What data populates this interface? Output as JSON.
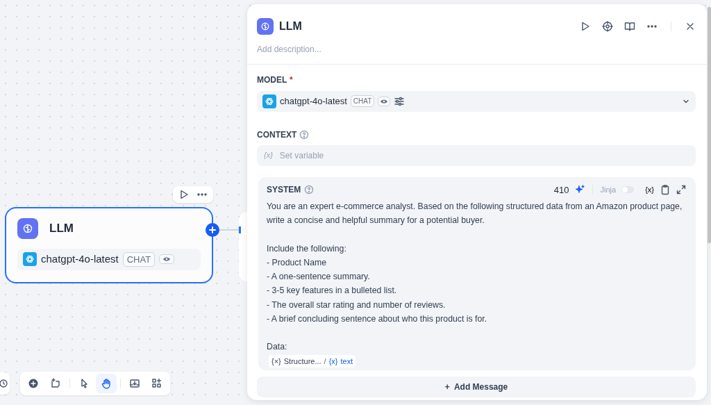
{
  "canvas": {
    "node": {
      "title": "LLM",
      "model": "chatgpt-4o-latest",
      "mode_tag": "CHAT",
      "selected": true
    },
    "toolbar": [
      {
        "kind": "add",
        "selected": false
      },
      {
        "kind": "note",
        "selected": false
      },
      {
        "kind": "pointer",
        "selected": false
      },
      {
        "kind": "hand",
        "selected": true
      },
      {
        "kind": "export",
        "selected": false
      },
      {
        "kind": "apps",
        "selected": false
      }
    ]
  },
  "panel": {
    "title": "LLM",
    "description_placeholder": "Add description...",
    "model_label": "MODEL",
    "required_mark": "*",
    "model": {
      "name": "chatgpt-4o-latest",
      "tag": "CHAT"
    },
    "context_label": "CONTEXT",
    "context_glyph": "{x}",
    "context_placeholder": "Set variable",
    "system": {
      "label": "SYSTEM",
      "token_count": "410",
      "jinja_label": "Jinja",
      "jinja_on": false,
      "var_glyph": "{x}",
      "paragraphs": [
        "You are an expert e-commerce analyst. Based on the following structured data from an Amazon product page, write a concise and helpful summary for a potential buyer.",
        "Include the following:\n- Product Name\n- A one-sentence summary.\n- 3-5 key features in a bulleted list.\n- The overall star rating and number of reviews.\n- A brief concluding sentence about who this product is for.",
        "Data:"
      ],
      "variable": {
        "node_glyph": "{×}",
        "node": "Structure...",
        "separator": "/",
        "var_glyph": "{x}",
        "name": "text"
      }
    },
    "add_message": "Add Message",
    "add_glyph": "+"
  }
}
